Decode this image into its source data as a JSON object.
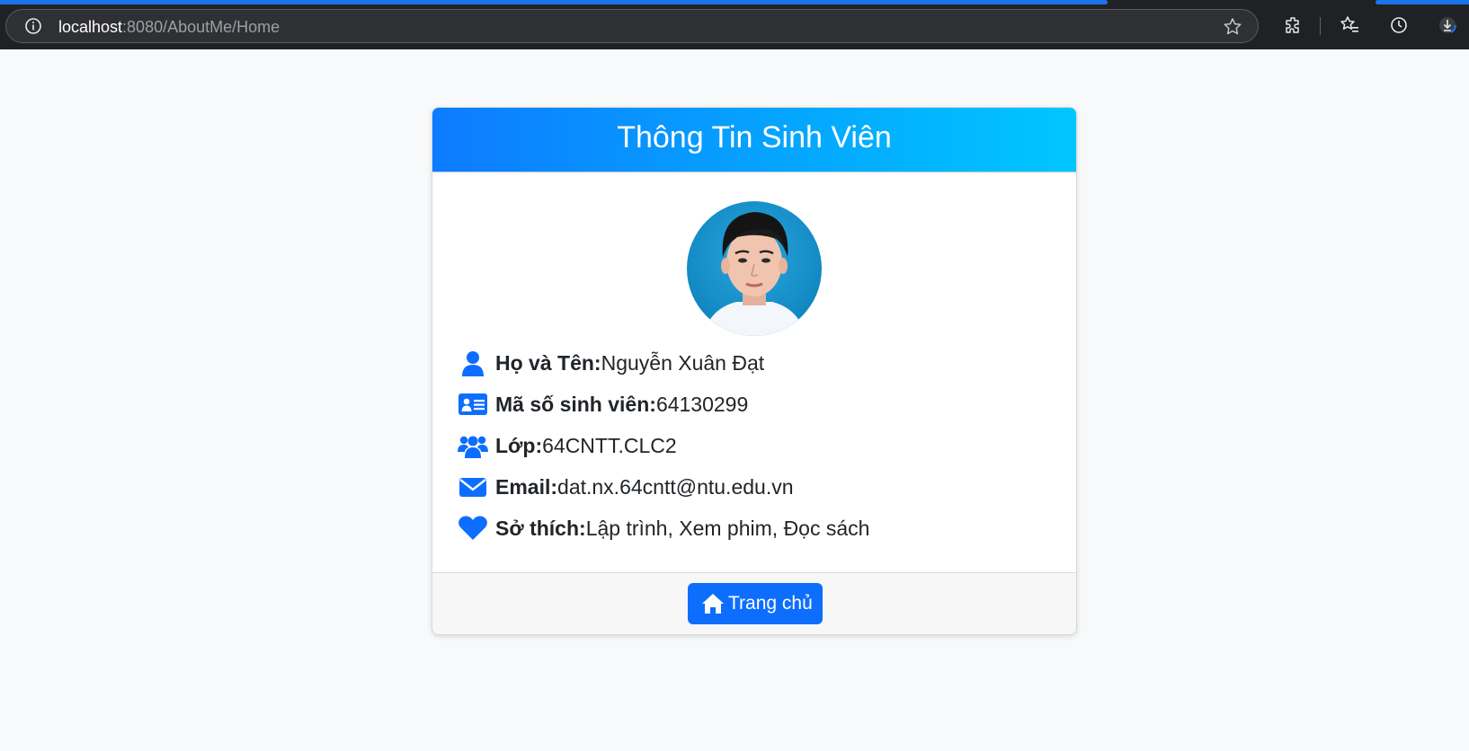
{
  "browser": {
    "url_host": "localhost",
    "url_path": ":8080/AboutMe/Home",
    "icons": [
      "info-icon",
      "star-icon",
      "extensions-icon",
      "favorites-icon",
      "history-icon",
      "downloads-icon"
    ]
  },
  "card": {
    "title": "Thông Tin Sinh Viên",
    "avatar_alt": "student-photo",
    "rows": [
      {
        "icon": "user-icon",
        "label": "Họ và Tên:",
        "value": "Nguyễn Xuân Đạt"
      },
      {
        "icon": "id-card-icon",
        "label": "Mã số sinh viên:",
        "value": "64130299"
      },
      {
        "icon": "users-icon",
        "label": "Lớp:",
        "value": "64CNTT.CLC2"
      },
      {
        "icon": "envelope-icon",
        "label": "Email:",
        "value": "dat.nx.64cntt@ntu.edu.vn"
      },
      {
        "icon": "heart-icon",
        "label": "Sở thích:",
        "value": "Lập trình, Xem phim, Đọc sách"
      }
    ],
    "home_button_label": "Trang chủ"
  },
  "colors": {
    "accent": "#0d6efd",
    "header_gradient_start": "#0d7bff",
    "header_gradient_end": "#00c6ff",
    "page_background": "#f8f9fa"
  }
}
